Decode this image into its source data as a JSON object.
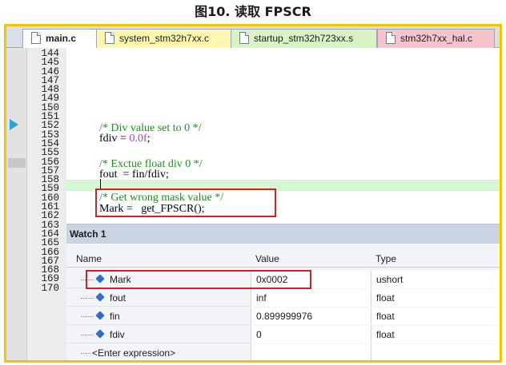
{
  "caption": "图10. 读取 FPSCR",
  "tabs": [
    {
      "label": "main.c",
      "style": "active"
    },
    {
      "label": "system_stm32h7xx.c",
      "style": "yellow"
    },
    {
      "label": "startup_stm32h723xx.s",
      "style": "green"
    },
    {
      "label": "stm32h7xx_hal.c",
      "style": "pink"
    }
  ],
  "line_numbers": [
    "144",
    "145",
    "146",
    "147",
    "148",
    "149",
    "150",
    "151",
    "152",
    "153",
    "154",
    "155",
    "156",
    "157",
    "158",
    "159",
    "160",
    "161",
    "162",
    "163",
    "164",
    "165",
    "166",
    "167",
    "168",
    "169",
    "170"
  ],
  "code": {
    "l148_comment": "/* Div value set to 0 */",
    "l149_a": "fdiv = ",
    "l149_b": "0.0f",
    "l149_c": ";",
    "l151_comment": "/* Exctue float div 0 */",
    "l152": "fout  = fin/fdiv;",
    "l154_comment": "/* Get wrong mask value */",
    "l155": "Mark =   get_FPSCR();"
  },
  "watch": {
    "title": "Watch 1",
    "headers": {
      "name": "Name",
      "value": "Value",
      "type": "Type"
    },
    "rows": [
      {
        "name": "Mark",
        "value": "0x0002",
        "type": "ushort"
      },
      {
        "name": "fout",
        "value": "inf",
        "type": "float"
      },
      {
        "name": "fin",
        "value": "0.899999976",
        "type": "float"
      },
      {
        "name": "fdiv",
        "value": "0",
        "type": "float"
      }
    ],
    "enter_expression": "<Enter expression>"
  },
  "colors": {
    "frame": "#f5c400",
    "highlight_box": "#d42020",
    "comment": "#1a8f1a",
    "number": "#b03bbf"
  }
}
